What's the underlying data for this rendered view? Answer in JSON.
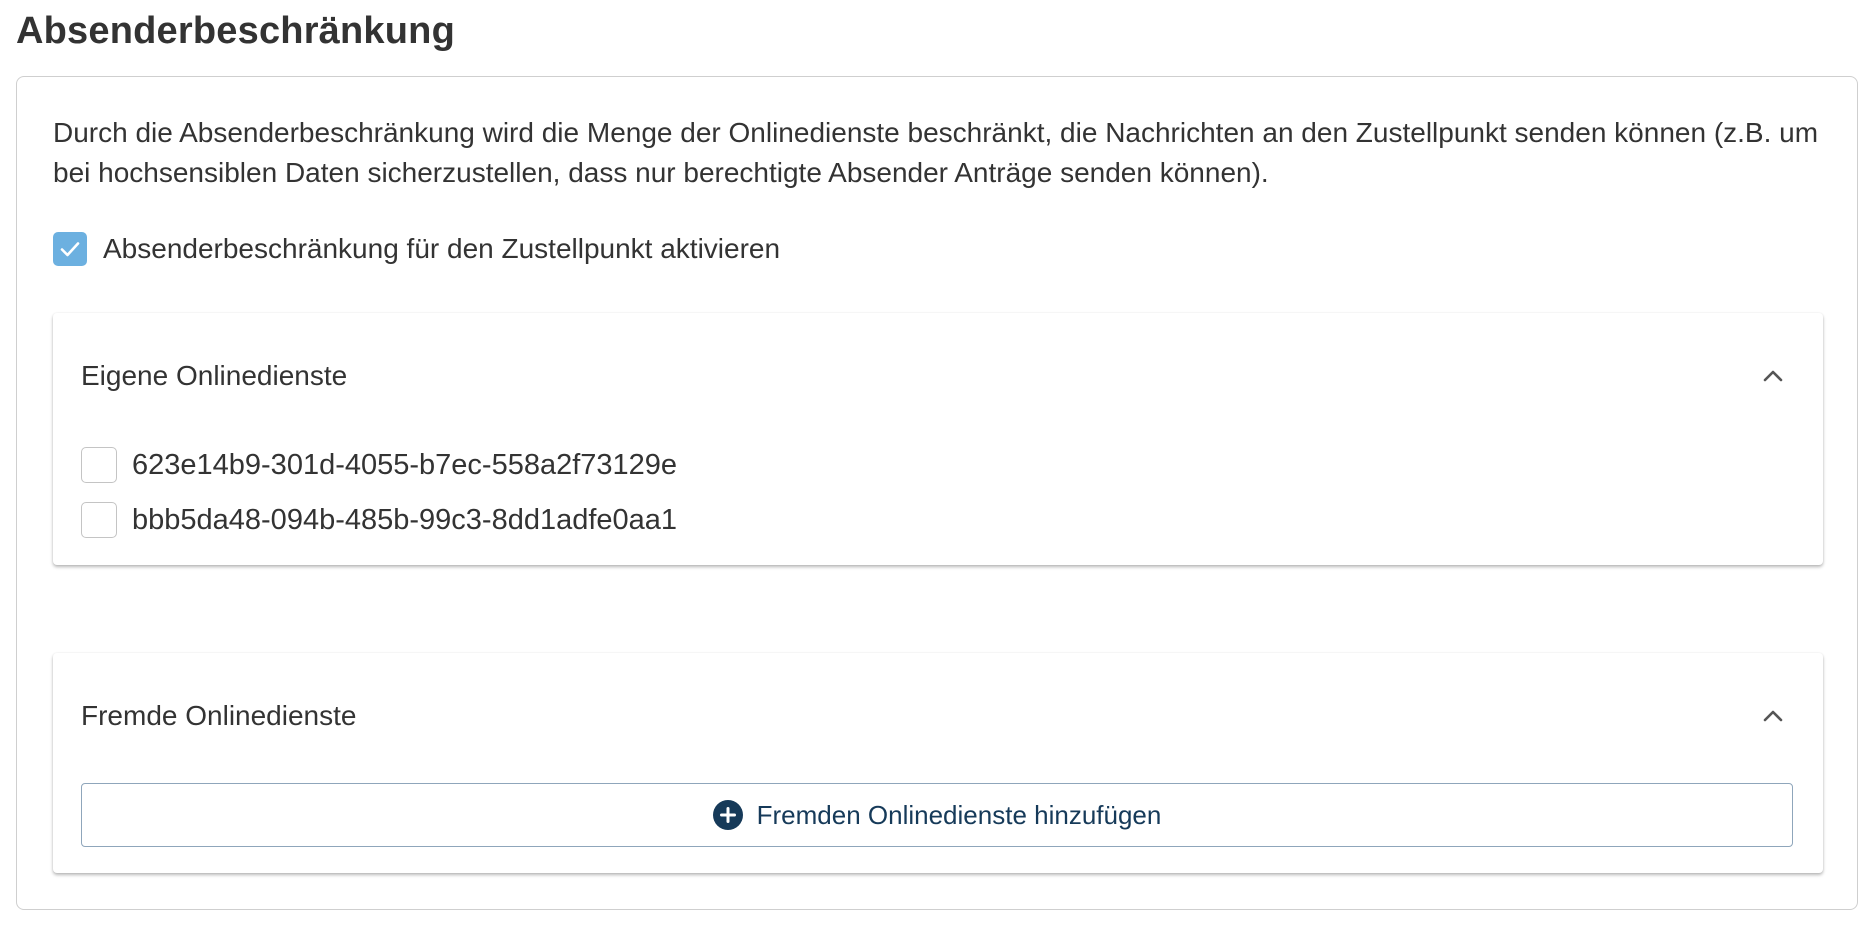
{
  "page": {
    "title": "Absenderbeschränkung"
  },
  "card": {
    "description": "Durch die Absenderbeschränkung wird die Menge der Onlinedienste beschränkt, die Nachrichten an den Zustellpunkt senden können (z.B. um bei hochsensiblen Daten sicherzustellen, dass nur berechtigte Absender Anträge senden können).",
    "activate_checkbox": {
      "label": "Absenderbeschränkung für den Zustellpunkt aktivieren",
      "checked": true
    }
  },
  "own_services": {
    "title": "Eigene Onlinedienste",
    "expanded": true,
    "items": [
      {
        "label": "623e14b9-301d-4055-b7ec-558a2f73129e",
        "checked": false
      },
      {
        "label": "bbb5da48-094b-485b-99c3-8dd1adfe0aa1",
        "checked": false
      }
    ]
  },
  "foreign_services": {
    "title": "Fremde Onlinedienste",
    "expanded": true,
    "add_button_label": "Fremden Onlinedienste hinzufügen"
  },
  "icons": {
    "checkmark": "check-icon",
    "collapse": "chevron-up-icon",
    "add": "plus-circle-icon"
  },
  "colors": {
    "checkbox_checked": "#6cb0e0",
    "button_text": "#163a59",
    "button_border": "#8fa6bb"
  }
}
